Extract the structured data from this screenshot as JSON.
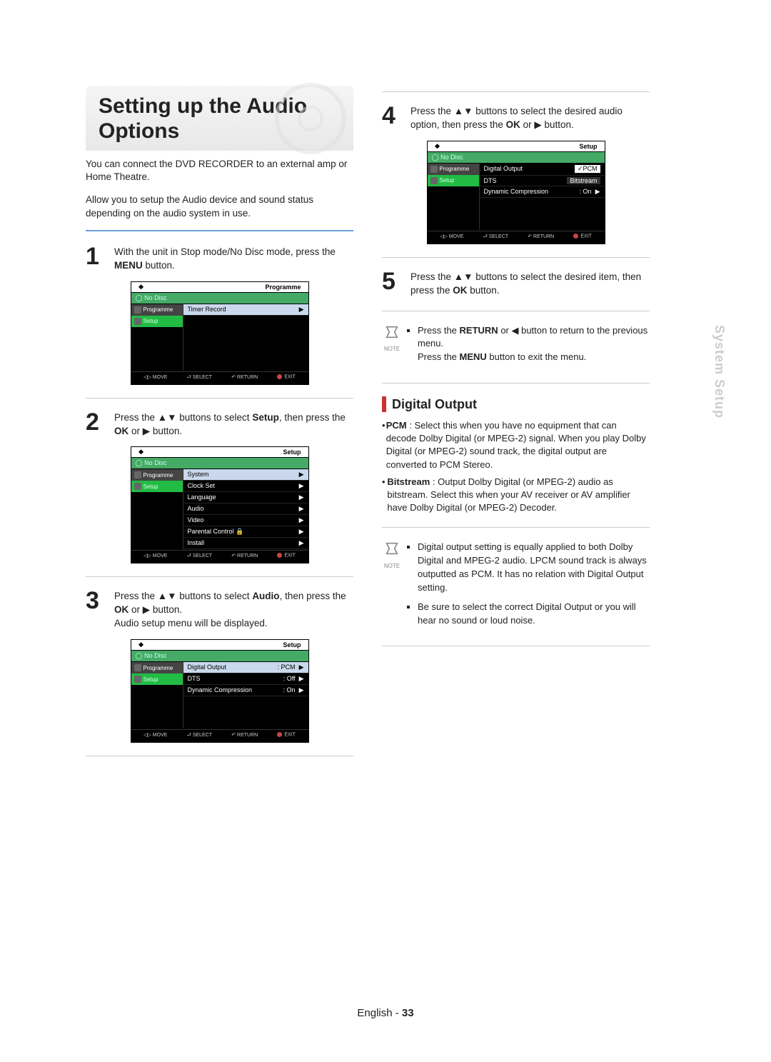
{
  "title": "Setting up the Audio Options",
  "intro1": "You can connect the DVD RECORDER to an external amp or Home Theatre.",
  "intro2": "Allow you to setup the Audio device and sound status depending on the audio system in use.",
  "tab": "System Setup",
  "footer_lang": "English",
  "footer_page": "33",
  "steps": {
    "s1": {
      "num": "1",
      "text_a": "With the unit in Stop mode/No Disc mode, press the ",
      "bold_a": "MENU",
      "text_b": " button."
    },
    "s2": {
      "num": "2",
      "text_a": "Press the ▲▼ buttons to select ",
      "bold_a": "Setup",
      "text_b": ", then press the ",
      "bold_b": "OK",
      "text_c": " or ▶ button."
    },
    "s3": {
      "num": "3",
      "text_a": "Press the ▲▼ buttons to select ",
      "bold_a": "Audio",
      "text_b": ", then press the ",
      "bold_b": "OK",
      "text_c": " or ▶ button.",
      "text_d": "Audio setup menu will be displayed."
    },
    "s4": {
      "num": "4",
      "text_a": "Press the ▲▼ buttons to select the desired audio option, then press the ",
      "bold_a": "OK",
      "text_b": " or ▶ button."
    },
    "s5": {
      "num": "5",
      "text_a": "Press the ▲▼ buttons to select the desired item, then press the ",
      "bold_a": "OK",
      "text_b": " button."
    }
  },
  "note1": {
    "l1a": "Press the ",
    "l1b": "RETURN",
    "l1c": " or ◀ button to return to the previous menu.",
    "l2a": "Press the ",
    "l2b": "MENU",
    "l2c": " button to exit the menu."
  },
  "section": "Digital Output",
  "pcm_label": "PCM",
  "pcm_text": " : Select this when you have no equipment that can decode Dolby Digital (or MPEG-2) signal. When you play Dolby Digital (or MPEG-2) sound track, the digital output are converted to PCM Stereo.",
  "bit_label": "Bitstream",
  "bit_text": " : Output Dolby Digital (or MPEG-2) audio as bitstream. Select this when your AV receiver or AV amplifier have Dolby Digital (or MPEG-2) Decoder.",
  "note2_a": "Digital output setting is equally applied to both Dolby Digital and MPEG-2 audio. LPCM sound track is always outputted as PCM. It has no relation with Digital Output setting.",
  "note2_b": "Be sure to select the correct Digital Output or you will hear no sound or loud noise.",
  "note_label": "NOTE",
  "menu": {
    "nodisk": "No Disc",
    "side_prog": "Programme",
    "side_setup": "Setup",
    "foot_move": "MOVE",
    "foot_select": "SELECT",
    "foot_return": "RETURN",
    "foot_exit": "EXIT",
    "m1": {
      "top": "Programme",
      "row1": "Timer Record"
    },
    "m2": {
      "top": "Setup",
      "rows": [
        "System",
        "Clock Set",
        "Language",
        "Audio",
        "Video",
        "Parental Control",
        "Install"
      ]
    },
    "m3": {
      "top": "Setup",
      "r1l": "Digital Output",
      "r1r": ": PCM",
      "r2l": "DTS",
      "r2r": ": Off",
      "r3l": "Dynamic Compression",
      "r3r": ": On"
    },
    "m4": {
      "top": "Setup",
      "r1l": "Digital Output",
      "r1r": "✓PCM",
      "r2l": "DTS",
      "r2r": "Bitstream",
      "r3l": "Dynamic Compression",
      "r3r": ": On"
    }
  }
}
